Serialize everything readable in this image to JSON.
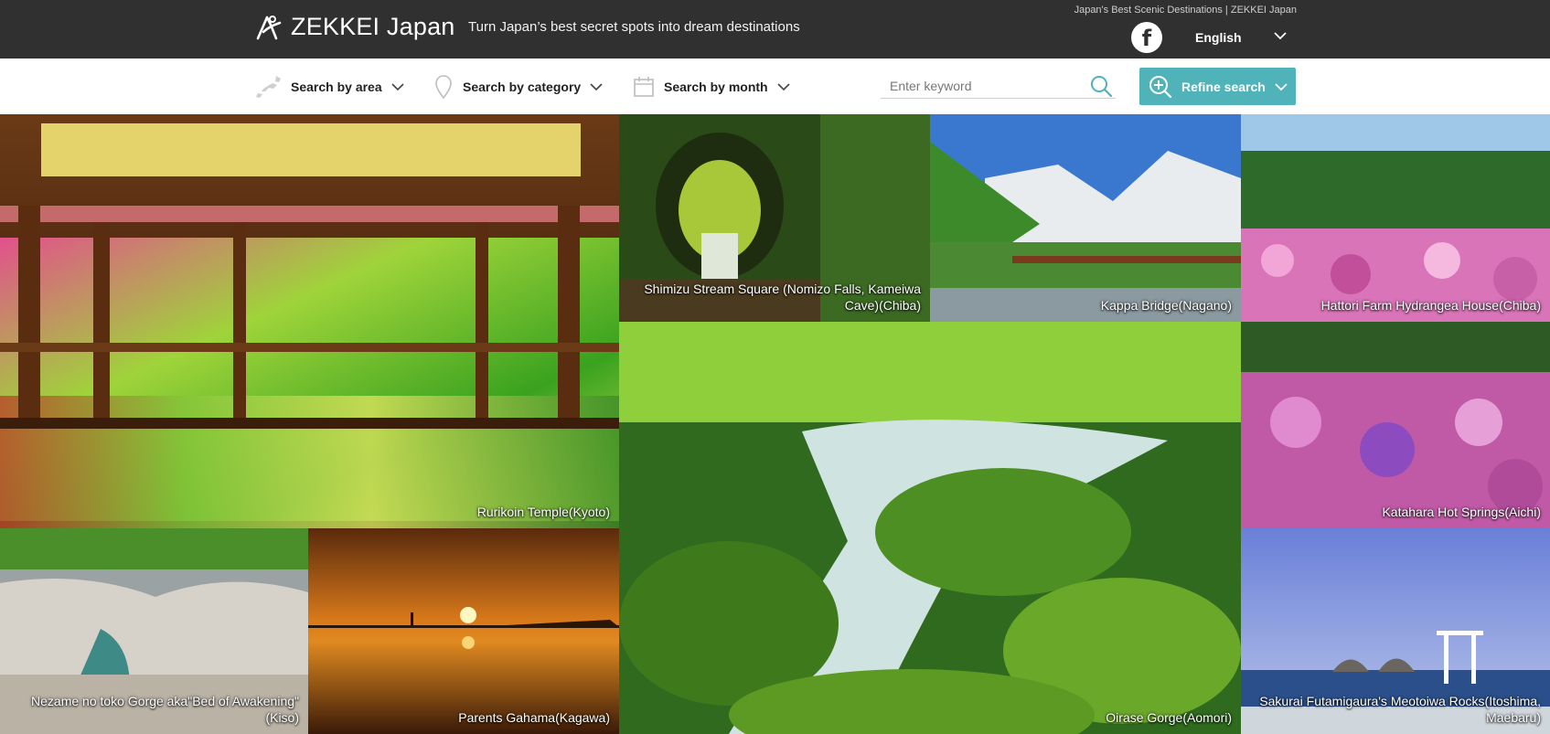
{
  "header": {
    "logo": "ZEKKEI Japan",
    "tagline": "Turn Japan’s best secret spots into dream destinations",
    "top_link": "Japan's Best Scenic Destinations | ZEKKEI Japan",
    "facebook_icon": "f",
    "language": "English"
  },
  "search": {
    "area": "Search by area",
    "category": "Search by category",
    "month": "Search by month",
    "keyword_placeholder": "Enter keyword",
    "refine": "Refine search"
  },
  "tiles": [
    {
      "caption": "Rurikoin Temple(Kyoto)"
    },
    {
      "caption": "Shimizu Stream Square (Nomizo Falls, Kameiwa Cave)(Chiba)"
    },
    {
      "caption": "Kappa Bridge(Nagano)"
    },
    {
      "caption": "Hattori Farm Hydrangea House(Chiba)"
    },
    {
      "caption": "Oirase Gorge(Aomori)"
    },
    {
      "caption": "Katahara Hot Springs(Aichi)"
    },
    {
      "caption": "Nezame no toko Gorge aka\"Bed of Awakening\"(Kiso)"
    },
    {
      "caption": "Parents Gahama(Kagawa)"
    },
    {
      "caption": "Sakurai Futamigaura's Meotoiwa Rocks(Itoshima, Maebaru)"
    }
  ],
  "colors": {
    "header_bg": "#303030",
    "accent": "#4fb3b9"
  }
}
